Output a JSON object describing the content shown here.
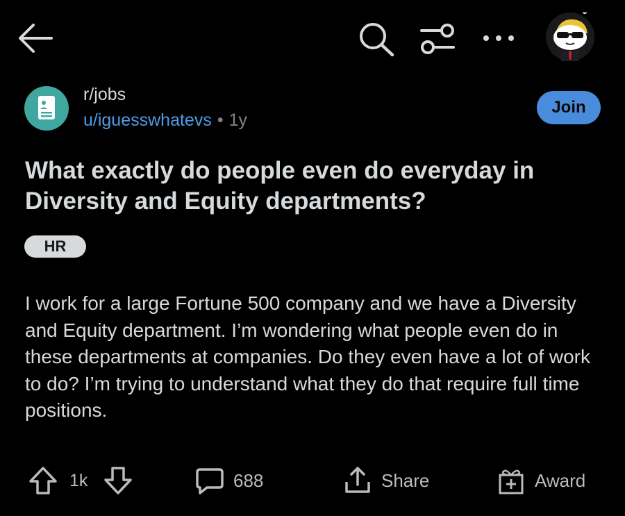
{
  "header": {
    "icons": [
      "back-arrow-icon",
      "search-icon",
      "filter-icon",
      "more-icon",
      "avatar"
    ]
  },
  "post": {
    "subreddit": "r/jobs",
    "author": "u/iguesswhatevs",
    "separator": "•",
    "age": "1y",
    "join_label": "Join",
    "title": "What exactly do people even do everyday in Diversity and Equity departments?",
    "flair": "HR",
    "body": "I work for a large Fortune 500 company and we have a Diversity and Equity department. I’m wondering what people even do in these departments at companies. Do they even have a lot of work to do? I’m trying to understand what they do that require full time positions."
  },
  "actions": {
    "votes": "1k",
    "comments": "688",
    "share_label": "Share",
    "award_label": "Award"
  },
  "colors": {
    "background": "#000000",
    "text": "#d7dadc",
    "accent": "#4a8cdc",
    "username": "#4f9be8",
    "sub_icon": "#3fa7a0"
  }
}
